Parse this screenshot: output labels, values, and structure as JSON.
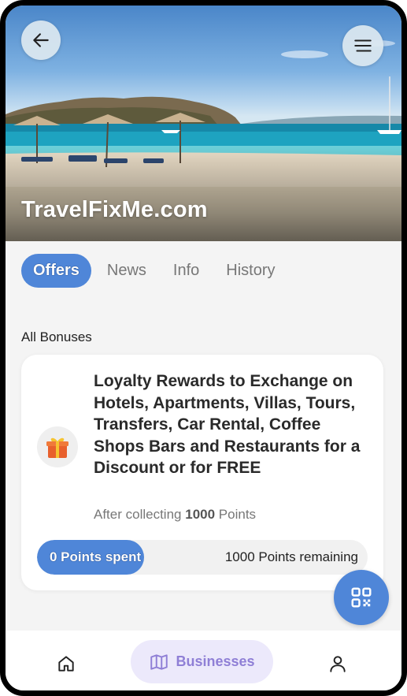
{
  "hero": {
    "title": "TravelFixMe.com",
    "back_icon": "arrow-left-icon",
    "menu_icon": "hamburger-menu-icon"
  },
  "tabs": [
    {
      "label": "Offers",
      "active": true
    },
    {
      "label": "News",
      "active": false
    },
    {
      "label": "Info",
      "active": false
    },
    {
      "label": "History",
      "active": false
    }
  ],
  "section_label": "All Bonuses",
  "offer": {
    "icon": "gift-icon",
    "title": "Loyalty Rewards to Exchange on Hotels, Apartments, Villas, Tours, Transfers, Car Rental, Coffee Shops Bars and Restaurants for a Discount or for FREE",
    "sub_prefix": "After collecting",
    "sub_points": "1000",
    "sub_suffix": "Points",
    "progress_spent": "0 Points spent",
    "progress_remaining": "1000 Points remaining"
  },
  "qr_icon": "qr-code-icon",
  "bottom_nav": {
    "home_icon": "home-icon",
    "businesses_label": "Businesses",
    "businesses_icon": "map-icon",
    "profile_icon": "user-icon"
  },
  "colors": {
    "accent": "#4f86d8",
    "nav_active_bg": "#ece9fb",
    "nav_active_text": "#8f7fd6"
  }
}
